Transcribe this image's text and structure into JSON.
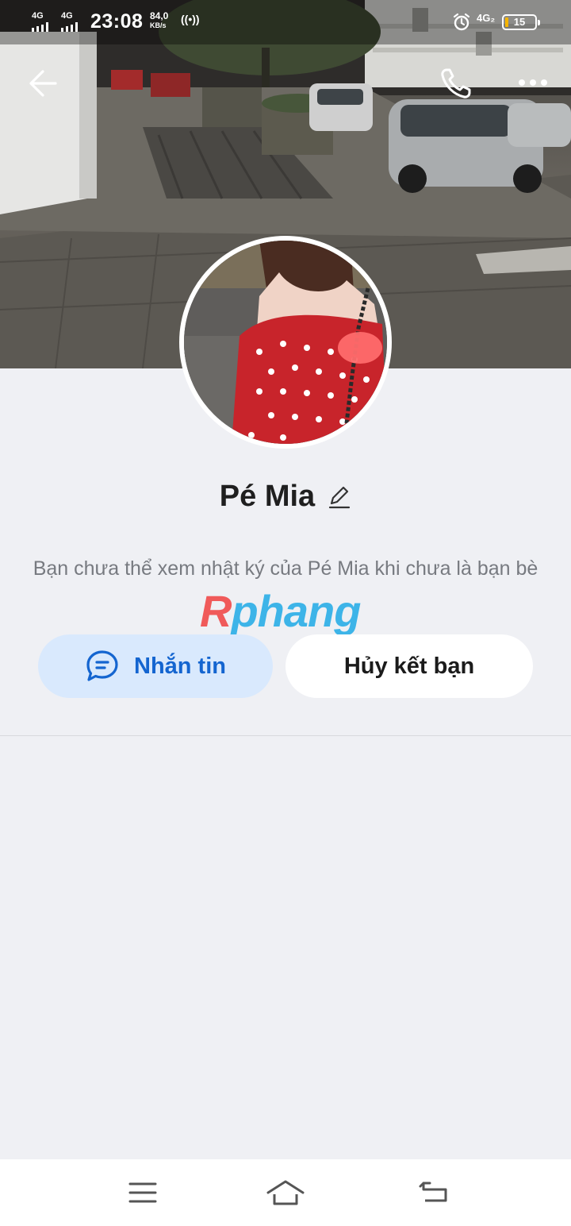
{
  "status_bar": {
    "sim1": "4G",
    "sim2": "4G",
    "time": "23:08",
    "speed_value": "84,0",
    "speed_unit": "KB/s",
    "hotspot": "((•))",
    "network2": "4G₂",
    "battery": "15"
  },
  "profile": {
    "name": "Pé Mia",
    "notice": "Bạn chưa thể xem nhật ký của Pé Mia khi chưa là bạn bè"
  },
  "watermark": {
    "first": "R",
    "rest": "phang"
  },
  "actions": {
    "message_label": "Nhắn tin",
    "unfriend_label": "Hủy kết bạn"
  },
  "icons": {
    "back": "back-arrow-icon",
    "call": "phone-icon",
    "more": "more-dots-icon",
    "edit": "pencil-icon",
    "message": "chat-bubble-icon",
    "nav_menu": "menu-icon",
    "nav_home": "home-icon",
    "nav_back": "return-icon"
  },
  "colors": {
    "accent": "#1465d0",
    "message_bg": "#d9e9fd",
    "page_bg": "#eff0f4"
  }
}
